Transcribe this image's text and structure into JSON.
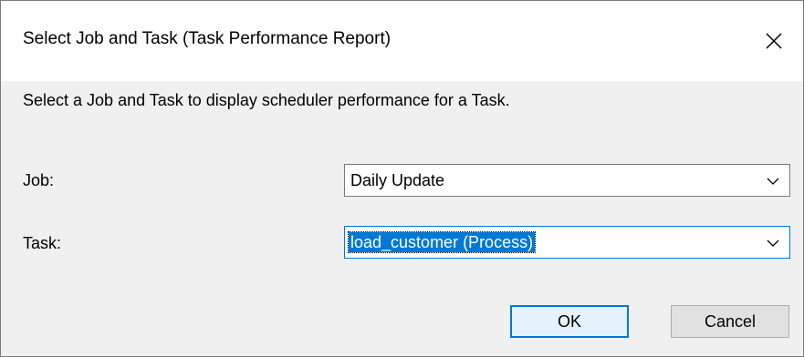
{
  "dialog": {
    "title": "Select Job and Task (Task Performance Report)",
    "description": "Select a Job and Task to display scheduler performance for a Task."
  },
  "fields": {
    "job": {
      "label": "Job:",
      "value": "Daily Update"
    },
    "task": {
      "label": "Task:",
      "value": "load_customer (Process)"
    }
  },
  "buttons": {
    "ok": "OK",
    "cancel": "Cancel"
  },
  "icons": {
    "close": "close-icon",
    "dropdown": "chevron-down-icon"
  },
  "colors": {
    "accent": "#0078d7",
    "dialog_bg": "#f0f0f0",
    "title_bg": "#ffffff"
  }
}
